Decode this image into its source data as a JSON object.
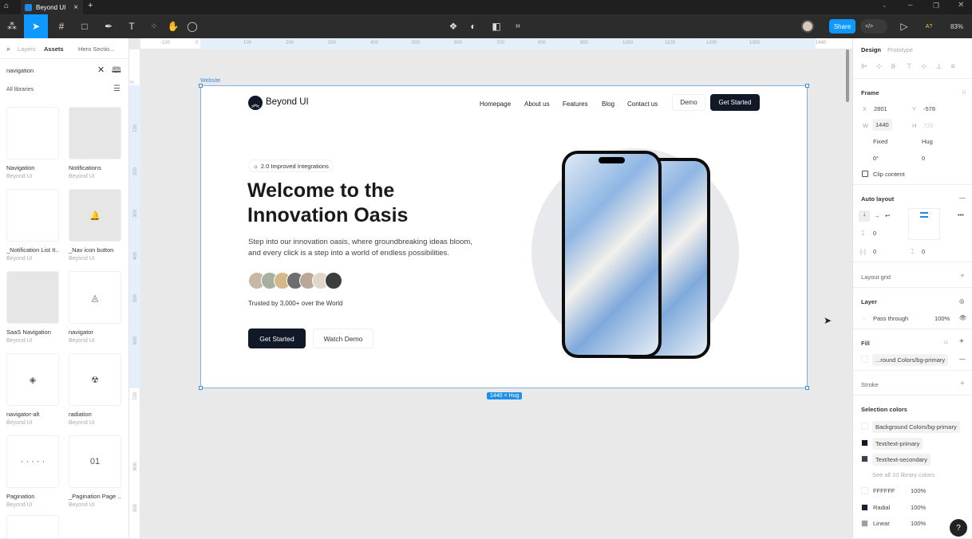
{
  "titlebar": {
    "tab_title": "Beyond UI",
    "new_tab": "+",
    "close": "×"
  },
  "toolbar": {
    "share": "Share",
    "zoom": "83%",
    "ai_label": "A?",
    "dev_mode": "</>"
  },
  "left_panel": {
    "tabs": [
      "Layers",
      "Assets"
    ],
    "page": "Hero Sectio...",
    "search_value": "navigation",
    "library_filter": "All libraries",
    "assets": [
      {
        "name": "Navigation",
        "lib": "Beyond UI",
        "thumb": ""
      },
      {
        "name": "Notifications",
        "lib": "Beyond UI",
        "thumb": ""
      },
      {
        "name": "_Notification List It...",
        "lib": "Beyond UI",
        "thumb": ""
      },
      {
        "name": "_Nav icon button",
        "lib": "Beyond UI",
        "thumb": "🔔"
      },
      {
        "name": "SaaS Navigation",
        "lib": "Beyond UI",
        "thumb": ""
      },
      {
        "name": "navigator",
        "lib": "Beyond UI",
        "thumb": "◬"
      },
      {
        "name": "navigator-alt",
        "lib": "Beyond UI",
        "thumb": "◈"
      },
      {
        "name": "radiation",
        "lib": "Beyond UI",
        "thumb": "☢"
      },
      {
        "name": "Pagination",
        "lib": "Beyond UI",
        "thumb": "· · · · ·"
      },
      {
        "name": "_Pagination Page ...",
        "lib": "Beyond UI",
        "thumb": "01"
      }
    ]
  },
  "rulers": {
    "h": [
      "-100",
      "0",
      "100",
      "200",
      "300",
      "400",
      "500",
      "600",
      "700",
      "800",
      "900",
      "1000",
      "1100",
      "1200",
      "1300",
      "1440"
    ],
    "v": [
      "0",
      "100",
      "200",
      "300",
      "400",
      "500",
      "600",
      "720",
      "800",
      "900"
    ]
  },
  "canvas": {
    "frame_label": "Website",
    "size_badge": "1440 × Hug"
  },
  "website": {
    "brand": "Beyond UI",
    "nav": [
      "Homepage",
      "About us",
      "Features",
      "Blog",
      "Contact us"
    ],
    "demo": "Demo",
    "get_started": "Get Started",
    "badge": "2.0 Improved Integrations",
    "headline_1": "Welcome to the",
    "headline_2": "Innovation Oasis",
    "sub_1": "Step into our innovation oasis, where groundbreaking ideas bloom,",
    "sub_2": "and every click is a step into a world of endless possibilities.",
    "trusted": "Trusted by 3,000+ over the World",
    "cta_primary": "Get Started",
    "cta_secondary": "Watch Demo"
  },
  "right_panel": {
    "tabs": [
      "Design",
      "Prototype"
    ],
    "frame": {
      "title": "Frame",
      "x_label": "X",
      "x": "2801",
      "y_label": "Y",
      "y": "-578",
      "w_label": "W",
      "w": "1440",
      "h_label": "H",
      "h": "720",
      "w_mode": "Fixed",
      "h_mode": "Hug",
      "rotation": "0°",
      "radius": "0",
      "clip": "Clip content"
    },
    "auto_layout": {
      "title": "Auto layout",
      "gap": "0",
      "pad_h": "0",
      "pad_v": "0"
    },
    "layout_grid": "Layout grid",
    "layer": {
      "title": "Layer",
      "blend": "Pass through",
      "opacity": "100%"
    },
    "fill": {
      "title": "Fill",
      "value": "...round Colors/bg-primary"
    },
    "stroke": "Stroke",
    "selection_colors": {
      "title": "Selection colors",
      "items": [
        {
          "name": "Background Colors/bg-primary",
          "color": "#ffffff"
        },
        {
          "name": "Text/text-primary",
          "color": "#111827"
        },
        {
          "name": "Text/text-secondary",
          "color": "#374151"
        }
      ],
      "see_all": "See all 10 library colors",
      "raw": [
        {
          "name": "FFFFFF",
          "opacity": "100%",
          "color": "#ffffff"
        },
        {
          "name": "Radial",
          "opacity": "100%",
          "color": "#1a1f33"
        },
        {
          "name": "Linear",
          "opacity": "100%",
          "color": "#9aa0a8"
        }
      ]
    },
    "help": "?"
  },
  "colors": {
    "accent": "#0d99ff",
    "dark": "#111827"
  }
}
